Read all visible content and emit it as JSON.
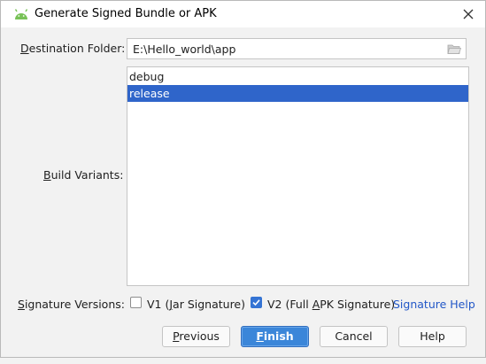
{
  "dialog": {
    "title": "Generate Signed Bundle or APK",
    "close_symbol": "✕"
  },
  "destination": {
    "label_key": "D",
    "label_rest": "estination Folder:",
    "value": "E:\\Hello_world\\app"
  },
  "build_variants": {
    "label_key": "B",
    "label_rest": "uild Variants:",
    "items": [
      {
        "label": "debug",
        "selected": false
      },
      {
        "label": "release",
        "selected": true
      }
    ]
  },
  "signature": {
    "label_key": "S",
    "label_rest": "ignature Versions:",
    "v1": {
      "label_pre": "V1 (",
      "label_key": "J",
      "label_post": "ar Signature)",
      "checked": false
    },
    "v2": {
      "label_pre": "V2 (Full ",
      "label_key": "A",
      "label_post": "PK Signature)",
      "checked": true
    },
    "help_link": "Signature Help"
  },
  "buttons": {
    "previous_key": "P",
    "previous_rest": "revious",
    "finish_key": "F",
    "finish_rest": "inish",
    "cancel": "Cancel",
    "help": "Help"
  },
  "colors": {
    "selection": "#2f65ca",
    "primary_button": "#3b86d9",
    "link": "#2257c7",
    "android_green": "#78c257"
  }
}
